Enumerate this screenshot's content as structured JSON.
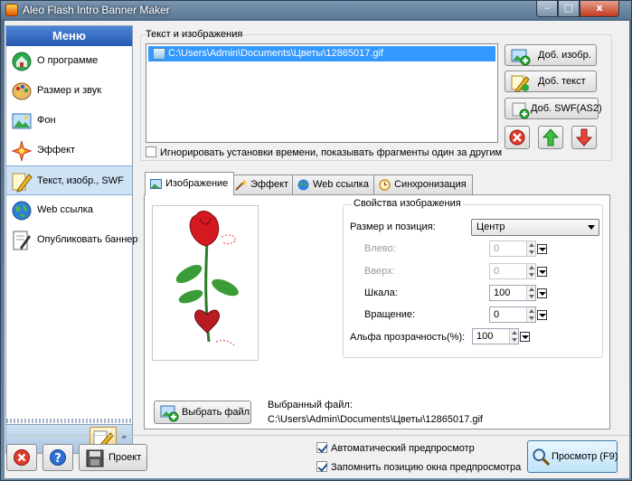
{
  "window": {
    "title": "Aleo Flash Intro Banner Maker",
    "min": "–",
    "max": "□",
    "close": "x"
  },
  "sidebar": {
    "header": "Меню",
    "items": [
      {
        "label": "О программе",
        "icon": "info-globe-icon",
        "active": false
      },
      {
        "label": "Размер и звук",
        "icon": "palette-icon",
        "active": false
      },
      {
        "label": "Фон",
        "icon": "picture-icon",
        "active": false
      },
      {
        "label": "Эффект",
        "icon": "sparkle-icon",
        "active": false
      },
      {
        "label": "Текст, изобр., SWF",
        "icon": "pencil-icon",
        "active": true
      },
      {
        "label": "Web ссылка",
        "icon": "globe-icon",
        "active": false
      },
      {
        "label": "Опубликовать баннер",
        "icon": "publish-icon",
        "active": false
      }
    ],
    "footer_more": "»"
  },
  "text_images": {
    "group_label": "Текст и изображения",
    "items": [
      "C:\\Users\\Admin\\Documents\\Цветы\\12865017.gif"
    ],
    "add_image": "Доб. изобр.",
    "add_text": "Доб. текст",
    "add_swf": "Доб. SWF(AS2)",
    "ignore_timing": "Игнорировать установки времени, показывать фрагменты один за другим",
    "ignore_timing_checked": false
  },
  "tabs": [
    {
      "label": "Изображение",
      "icon": "image-icon",
      "active": true
    },
    {
      "label": "Эффект",
      "icon": "wand-icon",
      "active": false
    },
    {
      "label": "Web ссылка",
      "icon": "globe-icon",
      "active": false
    },
    {
      "label": "Синхронизация",
      "icon": "clock-icon",
      "active": false
    }
  ],
  "image_tab": {
    "props_title": "Свойства изображения",
    "size_position_label": "Размер и позиция:",
    "size_position_value": "Центр",
    "left_label": "Влево:",
    "left_value": "0",
    "top_label": "Вверх:",
    "top_value": "0",
    "scale_label": "Шкала:",
    "scale_value": "100",
    "rotation_label": "Вращение:",
    "rotation_value": "0",
    "alpha_label": "Альфа прозрачность(%):",
    "alpha_value": "100",
    "choose_file": "Выбрать файл",
    "selected_file_label": "Выбранный файл:",
    "selected_file_path": "C:\\Users\\Admin\\Documents\\Цветы\\12865017.gif"
  },
  "bottom": {
    "project": "Проект",
    "auto_preview": "Автоматический предпросмотр",
    "auto_preview_checked": true,
    "remember_position": "Запомнить позицию окна предпросмотра",
    "remember_position_checked": true,
    "preview": "Просмотр (F9)"
  },
  "colors": {
    "accent": "#2457b0",
    "selection": "#3399ff",
    "active_item": "#cfe3f7"
  }
}
